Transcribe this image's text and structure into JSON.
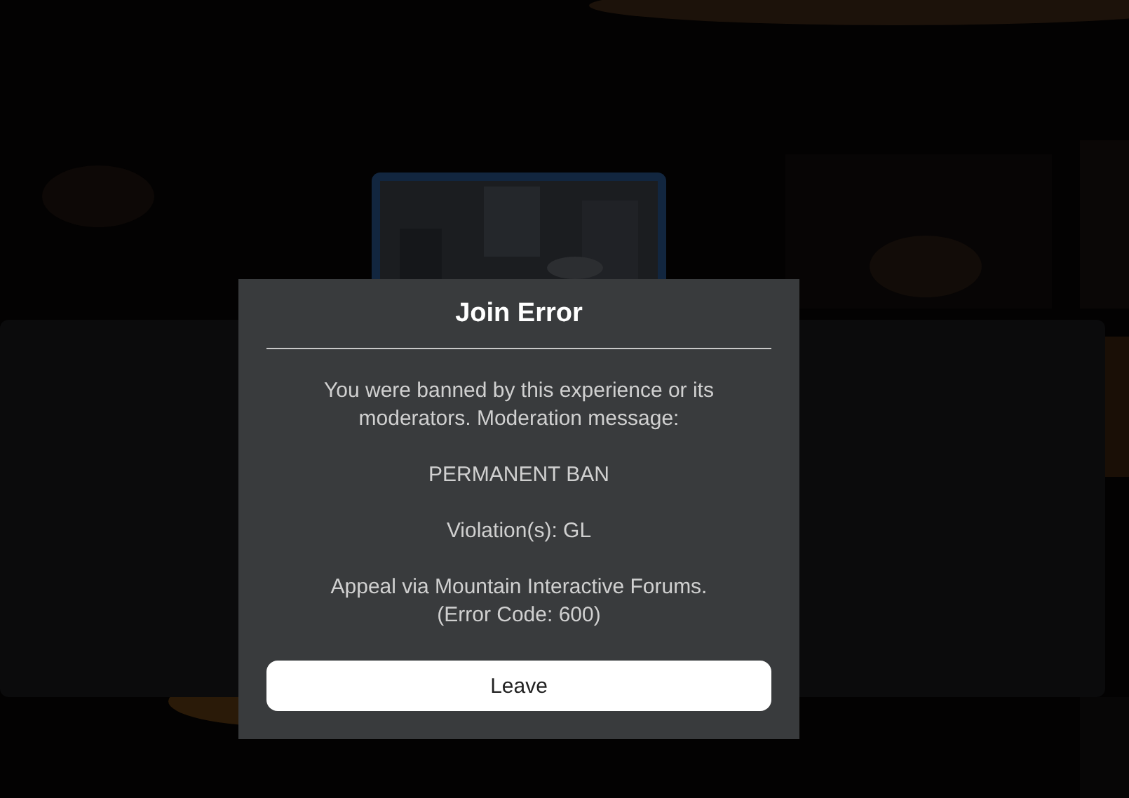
{
  "dialog": {
    "title": "Join Error",
    "paragraphs": [
      "You were banned by this experience or its moderators. Moderation message:",
      "PERMANENT BAN",
      "Violation(s): GL",
      "Appeal via Mountain Interactive Forums. (Error Code: 600)"
    ],
    "buttons": [
      "Leave"
    ]
  }
}
